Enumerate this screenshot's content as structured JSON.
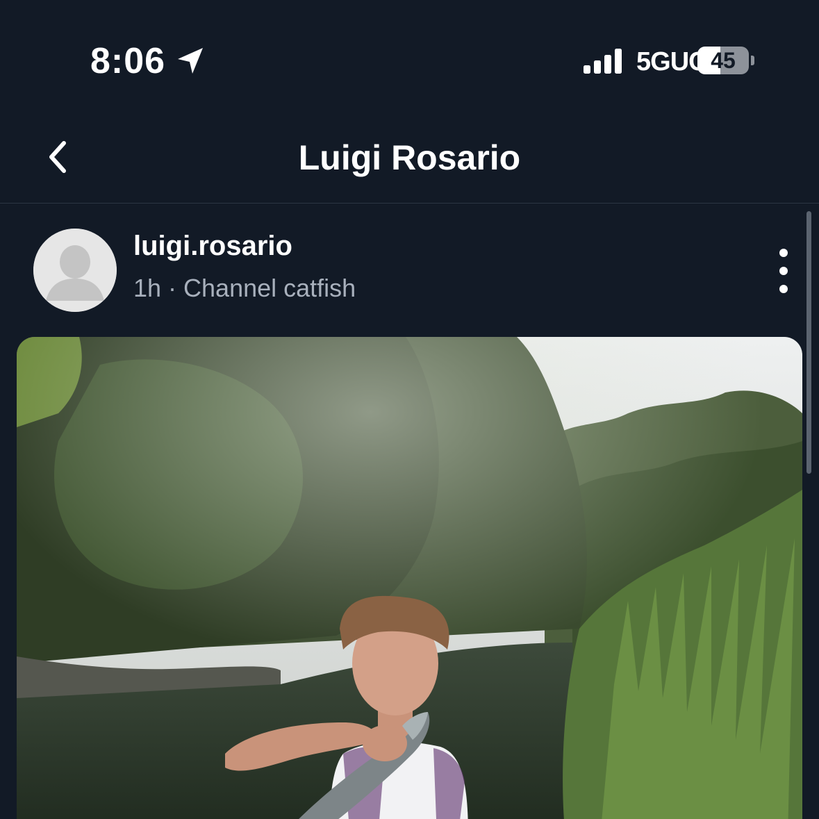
{
  "status_bar": {
    "time": "8:06",
    "network": "5GUC",
    "battery_level": "45",
    "battery_fraction": 0.45,
    "location_icon": "location-arrow-icon",
    "signal_icon": "cellular-signal-icon"
  },
  "nav": {
    "title": "Luigi Rosario",
    "back_icon": "chevron-left-icon"
  },
  "post": {
    "username": "luigi.rosario",
    "time_ago": "1h",
    "separator": "·",
    "species": "Channel catfish",
    "meta": "1h · Channel catfish",
    "avatar_icon": "default-avatar-icon",
    "more_icon": "more-vertical-icon",
    "photo_icon": "catch-photo"
  },
  "colors": {
    "background": "#121a26",
    "text_primary": "#ffffff",
    "text_secondary": "#a8b0bc",
    "divider": "#2c3644"
  }
}
